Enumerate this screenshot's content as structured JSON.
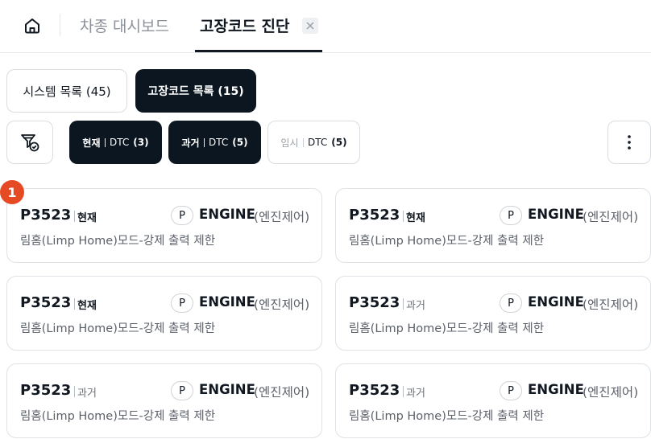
{
  "header": {
    "tabs": [
      {
        "label": "차종 대시보드",
        "active": false
      },
      {
        "label": "고장코드 진단",
        "active": true
      }
    ],
    "home_icon": "home-icon",
    "close_icon": "close-icon"
  },
  "list_toggle": {
    "system_list": "시스템 목록 (45)",
    "dtc_list": "고장코드 목록 (15)"
  },
  "filters": {
    "filter_icon": "filter-check-icon",
    "chips": [
      {
        "state": "현재",
        "type": "DTC",
        "count": "(3)",
        "selected": true
      },
      {
        "state": "과거",
        "type": "DTC",
        "count": "(5)",
        "selected": true
      },
      {
        "state": "임시",
        "type": "DTC",
        "count": "(5)",
        "selected": false
      }
    ],
    "more_icon": "more-vertical-icon"
  },
  "marker": "1",
  "cards": [
    {
      "code": "P3523",
      "state": "현재",
      "badge": "P",
      "system": "ENGINE",
      "system_sub": "(엔진제어)",
      "desc": "림홈(Limp Home)모드-강제 출력 제한"
    },
    {
      "code": "P3523",
      "state": "현재",
      "badge": "P",
      "system": "ENGINE",
      "system_sub": "(엔진제어)",
      "desc": "림홈(Limp Home)모드-강제 출력 제한"
    },
    {
      "code": "P3523",
      "state": "현재",
      "badge": "P",
      "system": "ENGINE",
      "system_sub": "(엔진제어)",
      "desc": "림홈(Limp Home)모드-강제 출력 제한"
    },
    {
      "code": "P3523",
      "state": "과거",
      "badge": "P",
      "system": "ENGINE",
      "system_sub": "(엔진제어)",
      "desc": "림홈(Limp Home)모드-강제 출력 제한"
    },
    {
      "code": "P3523",
      "state": "과거",
      "badge": "P",
      "system": "ENGINE",
      "system_sub": "(엔진제어)",
      "desc": "림홈(Limp Home)모드-강제 출력 제한"
    },
    {
      "code": "P3523",
      "state": "과거",
      "badge": "P",
      "system": "ENGINE",
      "system_sub": "(엔진제어)",
      "desc": "림홈(Limp Home)모드-강제 출력 제한"
    }
  ],
  "colors": {
    "dark": "#0b1620",
    "accent": "#e64a24"
  }
}
